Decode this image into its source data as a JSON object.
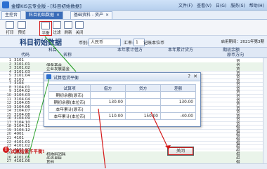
{
  "window": {
    "title": "金蝶KIS云专业版 - [科目初始数据]",
    "menu": [
      "文件(F)",
      "查看(V)",
      "日(G)",
      "服务(S)",
      "帮助(H)"
    ]
  },
  "tabs": [
    {
      "label": "主控台",
      "active": false
    },
    {
      "label": "科目初始数据",
      "active": true
    },
    {
      "label": "基础资料 - 资产",
      "active": false
    }
  ],
  "toolbar": {
    "buttons": [
      "打印",
      "预览",
      "平衡",
      "过滤",
      "刷新",
      "关闭"
    ]
  },
  "header": {
    "title": "科目初始数据",
    "currency_label": "币别:",
    "currency_value": "人民币",
    "rate_label": "汇率:",
    "rate_value": "1",
    "rate_note": "记账本位币",
    "period": "启用期间：2021年第3期"
  },
  "columns": {
    "subject": "科目",
    "code": "代码",
    "name": "名称",
    "year_debit": "本年累计借方",
    "year_credit": "本年累计贷方",
    "opening": "期初余额",
    "opening_sub": "原币",
    "direction": "方向"
  },
  "rows": [
    {
      "n": "1",
      "code": "3101",
      "name": "",
      "dir": "贷"
    },
    {
      "n": "2",
      "code": "3101.01",
      "name": "储备基金",
      "dir": "贷"
    },
    {
      "n": "3",
      "code": "3101.02",
      "name": "企业发展基金",
      "dir": "贷"
    },
    {
      "n": "4",
      "code": "3101.03",
      "name": "",
      "dir": "贷"
    },
    {
      "n": "5",
      "code": "3101.04",
      "name": "",
      "dir": "贷"
    },
    {
      "n": "6",
      "code": "3103",
      "name": "",
      "dir": "贷"
    },
    {
      "n": "7",
      "code": "3104",
      "name": "",
      "dir": "贷"
    },
    {
      "n": "8",
      "code": "3104.01",
      "name": "",
      "dir": "贷"
    },
    {
      "n": "9",
      "code": "3104.02",
      "name": "",
      "dir": "贷"
    },
    {
      "n": "10",
      "code": "3104.03",
      "name": "",
      "dir": "贷"
    },
    {
      "n": "11",
      "code": "3104.04",
      "name": "",
      "dir": "贷"
    },
    {
      "n": "12",
      "code": "3104.05",
      "name": "",
      "dir": "贷"
    },
    {
      "n": "13",
      "code": "3104.06",
      "name": "",
      "dir": "贷"
    },
    {
      "n": "14",
      "code": "3104.07",
      "name": "",
      "dir": "贷"
    },
    {
      "n": "15",
      "code": "3104.08",
      "name": "",
      "dir": "贷"
    },
    {
      "n": "16",
      "code": "3104.09",
      "name": "",
      "dir": "贷"
    },
    {
      "n": "17",
      "code": "3104.10",
      "name": "",
      "dir": "贷"
    },
    {
      "n": "18",
      "code": "3104.11",
      "name": "",
      "dir": "借"
    },
    {
      "n": "19",
      "code": "3104.12",
      "name": "",
      "dir": "借"
    },
    {
      "n": "20",
      "code": "4001",
      "name": "",
      "dir": "借"
    },
    {
      "n": "21",
      "code": "4101",
      "name": "",
      "dir": "借"
    },
    {
      "n": "22",
      "code": "4101.01",
      "name": "",
      "dir": "借"
    },
    {
      "n": "23",
      "code": "4101.02",
      "name": "",
      "dir": "借"
    },
    {
      "n": "24",
      "code": "4101.03",
      "name": "",
      "dir": "借"
    },
    {
      "n": "25",
      "code": "4101.04",
      "name": "机物料消耗",
      "dir": "借"
    },
    {
      "n": "26",
      "code": "4101.05",
      "name": "低值易耗",
      "dir": "借"
    },
    {
      "n": "27",
      "code": "4101.06",
      "name": "其他",
      "dir": "借"
    }
  ],
  "dialog": {
    "title": "试算借贷平衡",
    "help": "?",
    "close": "✕",
    "headers": [
      "试算项",
      "借方",
      "贷方",
      "差额"
    ],
    "lines": [
      {
        "label": "期初余额(原币)",
        "debit": "",
        "credit": "",
        "diff": ""
      },
      {
        "label": "期初余额(本位币)",
        "debit": "130.00",
        "credit": "",
        "diff": "130.00"
      },
      {
        "label": "本年累计(原币)",
        "debit": "",
        "credit": "",
        "diff": ""
      },
      {
        "label": "本年累计(本位币)",
        "debit": "110.00",
        "credit": "150.00",
        "diff": "-40.00"
      }
    ]
  },
  "status": {
    "message": "试算结果不平衡!",
    "close_button": "关闭"
  },
  "colors": {
    "accent": "#3a6cb8",
    "error": "#d21f1f",
    "arrow": "#2fa22f"
  }
}
